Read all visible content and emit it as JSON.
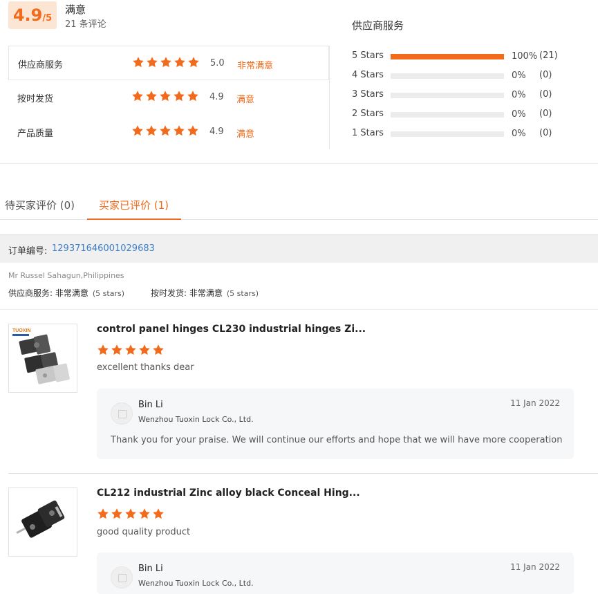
{
  "summary": {
    "score": "4.9",
    "score_max": "/5",
    "overall_label": "满意",
    "review_count": "21 条评论",
    "dimensions": [
      {
        "label": "供应商服务",
        "rating": 5.0,
        "score": "5.0",
        "satisfaction": "非常满意"
      },
      {
        "label": "按时发货",
        "rating": 4.9,
        "score": "4.9",
        "satisfaction": "满意"
      },
      {
        "label": "产品质量",
        "rating": 4.9,
        "score": "4.9",
        "satisfaction": "满意"
      }
    ],
    "breakdown_title": "供应商服务",
    "breakdown": [
      {
        "label": "5  Stars",
        "fraction": 1.0,
        "percent": "100%",
        "count": "(21)"
      },
      {
        "label": "4  Stars",
        "fraction": 0.0,
        "percent": "0%",
        "count": "(0)"
      },
      {
        "label": "3  Stars",
        "fraction": 0.0,
        "percent": "0%",
        "count": "(0)"
      },
      {
        "label": "2  Stars",
        "fraction": 0.0,
        "percent": "0%",
        "count": "(0)"
      },
      {
        "label": "1  Stars",
        "fraction": 0.0,
        "percent": "0%",
        "count": "(0)"
      }
    ]
  },
  "tabs": {
    "pending": "待买家评价 (0)",
    "reviewed": "买家已评价 (1)"
  },
  "order": {
    "label": "订单编号: ",
    "number": "129371646001029683"
  },
  "buyer": {
    "name": "Mr Russel Sahagun,Philippines",
    "ratings": [
      {
        "label": "供应商服务: ",
        "value": "非常满意",
        "note": "(5 stars)"
      },
      {
        "label": "按时发货: ",
        "value": "非常满意",
        "note": "(5 stars)"
      }
    ]
  },
  "reviews": [
    {
      "product_title": "control panel hinges CL230 industrial hinges Zi...",
      "rating": 5,
      "text": "excellent thanks dear",
      "reply": {
        "name": "Bin Li",
        "company": "Wenzhou Tuoxin Lock Co., Ltd.",
        "date": "11 Jan 2022",
        "text": "Thank you for your praise. We will continue our efforts and hope that we will have more cooperation"
      }
    },
    {
      "product_title": "CL212 industrial Zinc alloy black Conceal Hing...",
      "rating": 5,
      "text": "good quality product",
      "reply": {
        "name": "Bin Li",
        "company": "Wenzhou Tuoxin Lock Co., Ltd.",
        "date": "11 Jan 2022",
        "text": ""
      }
    }
  ],
  "thumb_logo_text": "TUOXIN",
  "colors": {
    "accent": "#f26a1b",
    "link": "#3a7ec8",
    "accent_bg": "#fde5d3"
  }
}
